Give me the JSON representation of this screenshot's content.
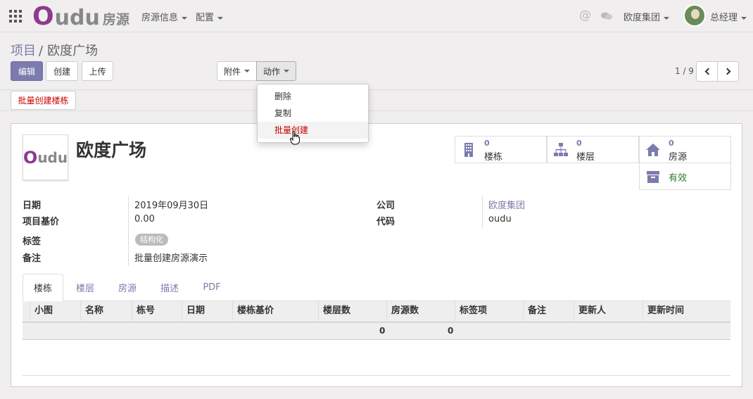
{
  "brand": {
    "name_o": "O",
    "name_rest": "udu",
    "app": "房源"
  },
  "nav": {
    "menu1": "房源信息",
    "menu2": "配置"
  },
  "topbar": {
    "at_symbol": "@",
    "company": "欧度集团",
    "user": "总经理"
  },
  "breadcrumb": {
    "parent": "项目",
    "separator": "/",
    "current": "欧度广场"
  },
  "buttons": {
    "edit": "编辑",
    "create": "创建",
    "upload": "上传",
    "attach": "附件",
    "action": "动作",
    "batch_building": "批量创建楼栋"
  },
  "pager": {
    "text": "1 / 9"
  },
  "action_menu": {
    "items": [
      "删除",
      "复制",
      "批量创建"
    ],
    "hovered": "批量创建"
  },
  "record": {
    "logo_o": "O",
    "logo_rest": "udu",
    "title": "欧度广场",
    "stats": [
      {
        "count": "0",
        "label": "楼栋",
        "icon": "building-icon"
      },
      {
        "count": "0",
        "label": "楼层",
        "icon": "sitemap-icon"
      },
      {
        "count": "0",
        "label": "房源",
        "icon": "home-icon"
      }
    ],
    "active_label": "有效",
    "fields": {
      "date_label": "日期",
      "date_value": "2019年09月30日",
      "base_price_label": "项目基价",
      "base_price_value": "0.00",
      "tag_label": "标签",
      "tag_value": "结构化",
      "note_label": "备注",
      "note_value": "批量创建房源演示",
      "company_label": "公司",
      "company_value": "欧度集团",
      "code_label": "代码",
      "code_value": "oudu"
    }
  },
  "tabs": [
    "楼栋",
    "楼层",
    "房源",
    "描述",
    "PDF"
  ],
  "table": {
    "columns": [
      "小图",
      "名称",
      "栋号",
      "日期",
      "楼栋基价",
      "楼层数",
      "房源数",
      "标签项",
      "备注",
      "更新人",
      "更新时间"
    ],
    "totals": {
      "floors": "0",
      "rooms": "0"
    }
  },
  "colors": {
    "brand_purple": "#8e3a8d",
    "primary": "#7c7bad",
    "danger": "#cc0000",
    "active_green": "#2a7a2a"
  }
}
